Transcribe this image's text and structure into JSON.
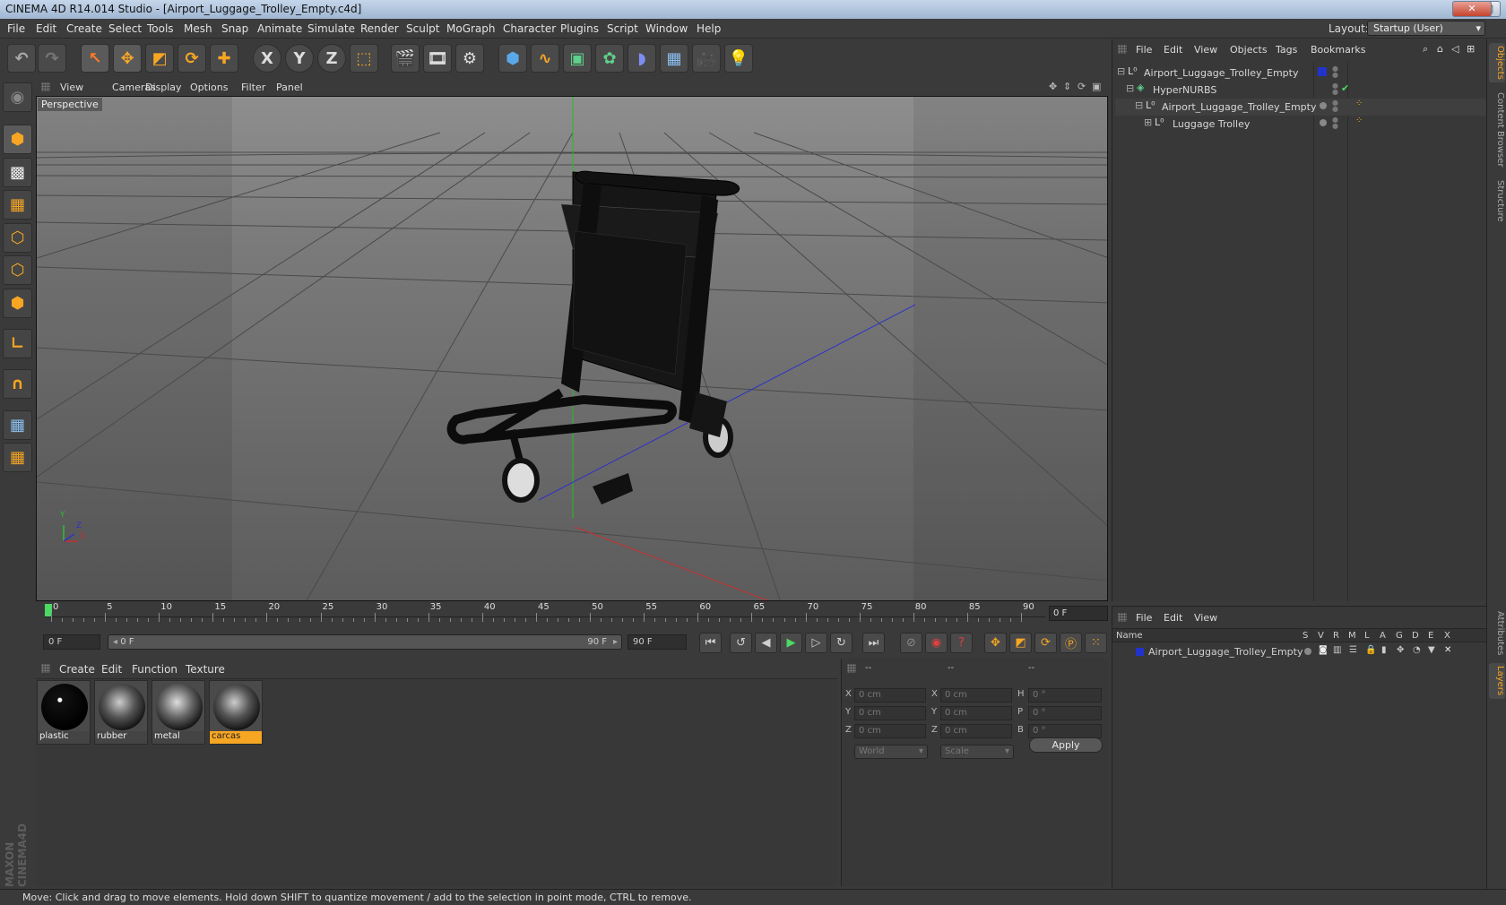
{
  "window": {
    "title": "CINEMA 4D R14.014 Studio - [Airport_Luggage_Trolley_Empty.c4d]",
    "min": "–",
    "max": "□",
    "close": "✕"
  },
  "menubar": {
    "items": [
      "File",
      "Edit",
      "Create",
      "Select",
      "Tools",
      "Mesh",
      "Snap",
      "Animate",
      "Simulate",
      "Render",
      "Sculpt",
      "MoGraph",
      "Character",
      "Plugins",
      "Script",
      "Window",
      "Help"
    ],
    "layout_label": "Layout:",
    "layout_value": "Startup (User)"
  },
  "toolbar": {
    "icons": [
      "undo-icon",
      "redo-icon",
      "live-selection-icon",
      "move-icon",
      "scale-icon",
      "rotate-icon",
      "create-icon",
      "x-axis-icon",
      "y-axis-icon",
      "z-axis-icon",
      "coordinate-system-icon",
      "render-view-icon",
      "render-active-icon",
      "render-settings-icon",
      "cube-icon",
      "spline-icon",
      "nurbs-icon",
      "array-icon",
      "deformer-icon",
      "floor-icon",
      "camera-icon",
      "light-icon"
    ],
    "x_label": "X",
    "y_label": "Y",
    "z_label": "Z"
  },
  "left_tools": [
    "make-editable-icon",
    "model-mode-icon",
    "texture-mode-icon",
    "workplane-icon",
    "points-mode-icon",
    "edges-mode-icon",
    "polygons-mode-icon",
    "axis-icon",
    "magnet-icon",
    "snap-lock-icon",
    "snap-settings-icon"
  ],
  "brand": {
    "text": "MAXON CINEMA4D"
  },
  "viewport": {
    "menu": [
      "View",
      "Cameras",
      "Display",
      "Options",
      "Filter",
      "Panel"
    ],
    "label": "Perspective",
    "axis_x": "X",
    "axis_y": "Y",
    "axis_z": "Z"
  },
  "timeline": {
    "ticks": [
      "0",
      "5",
      "10",
      "15",
      "20",
      "25",
      "30",
      "35",
      "40",
      "45",
      "50",
      "55",
      "60",
      "65",
      "70",
      "75",
      "80",
      "85",
      "90"
    ],
    "current_frame": "0 F"
  },
  "playback": {
    "start_frame": "0 F",
    "range_start": "0 F",
    "range_end": "90 F",
    "end_frame": "90 F"
  },
  "materials": {
    "menu": [
      "Create",
      "Edit",
      "Function",
      "Texture"
    ],
    "items": [
      {
        "name": "plastic",
        "selected": false
      },
      {
        "name": "rubber",
        "selected": false
      },
      {
        "name": "metal",
        "selected": false
      },
      {
        "name": "carcas",
        "selected": true
      }
    ]
  },
  "coords": {
    "headers": [
      "--",
      "--",
      "--"
    ],
    "rows": [
      {
        "a": "X",
        "av": "0 cm",
        "b": "X",
        "bv": "0 cm",
        "c": "H",
        "cv": "0 °"
      },
      {
        "a": "Y",
        "av": "0 cm",
        "b": "Y",
        "bv": "0 cm",
        "c": "P",
        "cv": "0 °"
      },
      {
        "a": "Z",
        "av": "0 cm",
        "b": "Z",
        "bv": "0 cm",
        "c": "B",
        "cv": "0 °"
      }
    ],
    "mode": "World",
    "type": "Scale",
    "apply": "Apply"
  },
  "object_manager": {
    "menu": [
      "File",
      "Edit",
      "View",
      "Objects",
      "Tags",
      "Bookmarks"
    ],
    "objects": [
      {
        "name": "Airport_Luggage_Trolley_Empty",
        "depth": 0,
        "type": "null"
      },
      {
        "name": "HyperNURBS",
        "depth": 1,
        "type": "nurbs"
      },
      {
        "name": "Airport_Luggage_Trolley_Empty",
        "depth": 2,
        "type": "null"
      },
      {
        "name": "Luggage Trolley",
        "depth": 3,
        "type": "null"
      }
    ]
  },
  "layer_manager": {
    "menu": [
      "File",
      "Edit",
      "View"
    ],
    "columns": [
      "Name",
      "S",
      "V",
      "R",
      "M",
      "L",
      "A",
      "G",
      "D",
      "E",
      "X"
    ],
    "layers": [
      {
        "name": "Airport_Luggage_Trolley_Empty",
        "color": "#2233cc"
      }
    ]
  },
  "right_tabs": [
    "Objects",
    "Content Browser",
    "Structure",
    "Attributes",
    "Layers"
  ],
  "status": "Move: Click and drag to move elements. Hold down SHIFT to quantize movement / add to the selection in point mode, CTRL to remove.",
  "colors": {
    "accent": "#f6a623",
    "layer_blue": "#2233cc",
    "playhead": "#4cd964"
  }
}
